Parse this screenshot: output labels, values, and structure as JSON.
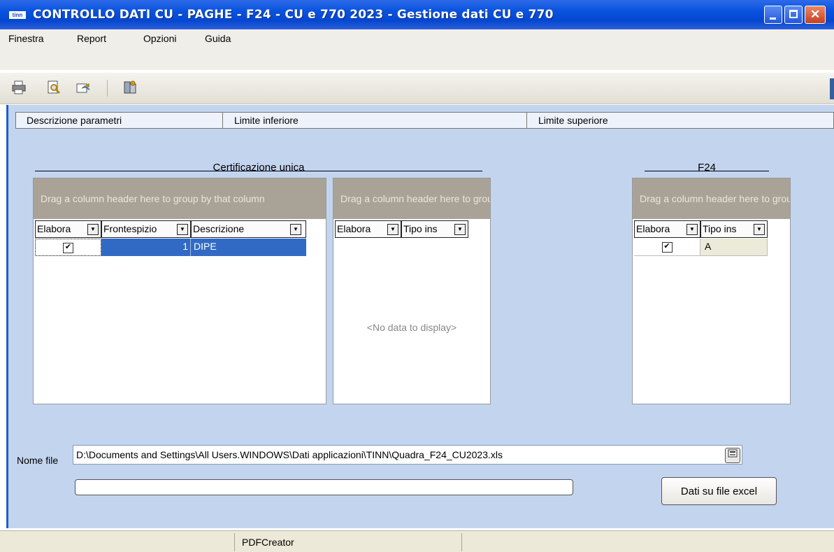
{
  "window": {
    "title": "CONTROLLO DATI CU - PAGHE - F24 - CU e 770 2023 - Gestione dati CU e 770",
    "app_icon_text": "tinn"
  },
  "menu": [
    "Finestra",
    "Report",
    "Opzioni",
    "Guida"
  ],
  "toolbar": {
    "icons": [
      "printer-icon",
      "print-preview-icon",
      "export-icon",
      "settings-icon"
    ]
  },
  "param_header": {
    "col1": "Descrizione parametri",
    "col2": "Limite inferiore",
    "col3": "Limite superiore"
  },
  "cu_section": {
    "title": "Certificazione unica",
    "grid1": {
      "group_panel": "Drag a column header here to group by that column",
      "columns": [
        "Elabora",
        "Frontespizio",
        "Descrizione"
      ],
      "rows": [
        {
          "elabora": true,
          "frontespizio": "1",
          "descrizione": "DIPE"
        }
      ]
    },
    "grid2": {
      "group_panel": "Drag a column header here to group by that column",
      "columns": [
        "Elabora",
        "Tipo ins"
      ],
      "empty_text": "<No data to display>"
    }
  },
  "f24_section": {
    "title": "F24",
    "grid": {
      "group_panel": "Drag a column header here to group by that column",
      "columns": [
        "Elabora",
        "Tipo ins"
      ],
      "rows": [
        {
          "elabora": true,
          "tipo_ins": "A"
        }
      ]
    }
  },
  "file": {
    "label": "Nome file",
    "value": "D:\\Documents and Settings\\All Users.WINDOWS\\Dati applicazioni\\TINN\\Quadra_F24_CU2023.xls"
  },
  "progress": 0,
  "export_button": "Dati su file excel",
  "status_bar": {
    "text": "PDFCreator"
  }
}
